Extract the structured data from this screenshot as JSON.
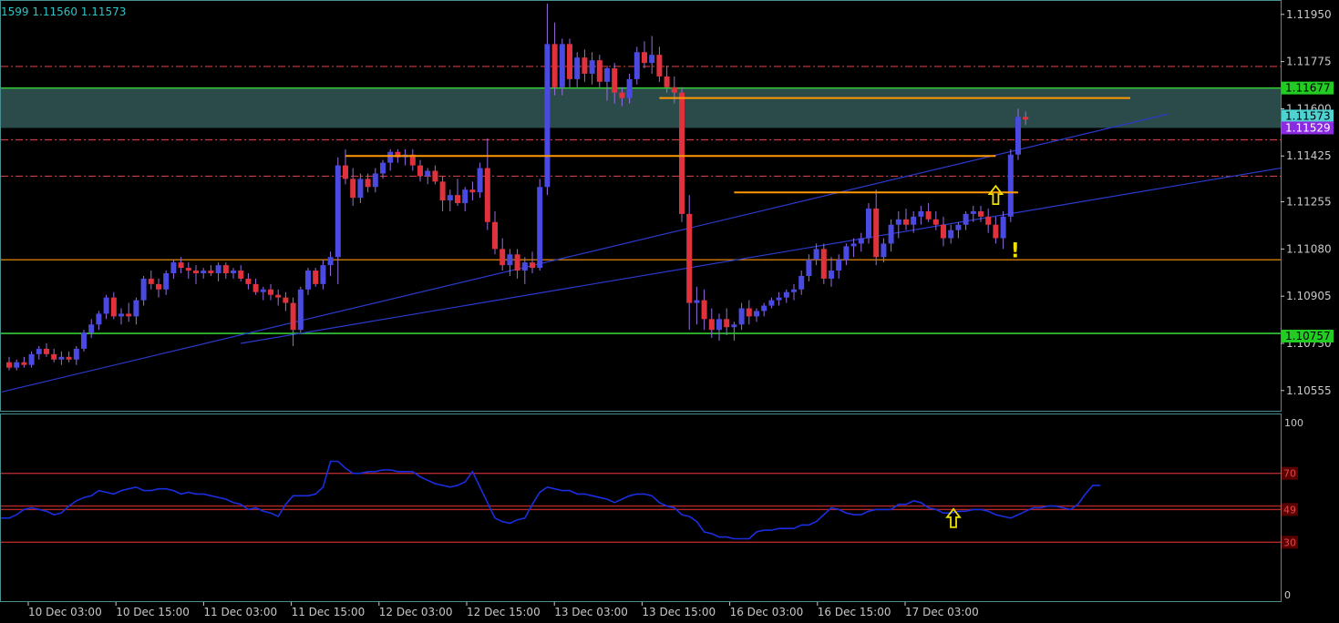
{
  "header": {
    "quote_text": "1599 1.11560 1.11573"
  },
  "colors": {
    "background": "#000000",
    "frame": "#4a8f8f",
    "bull": "#4a4ae0",
    "bear": "#e0323c",
    "wick": "#9a6de0",
    "support": "#ff9900",
    "zone_line": "#33cc33",
    "zone_fill": "#3a6464",
    "resistance_dash": "#c83c3c",
    "trend": "#2a3acc",
    "rsi_line": "#1a2ee0",
    "rsi_level": "#b42828",
    "arrow": "#f0e000",
    "axis_text": "#c8c8c8"
  },
  "chart_data": [
    {
      "type": "candlestick",
      "symbol": "",
      "price_axis_ticks": [
        "1.11950",
        "1.11775",
        "1.11600",
        "1.11425",
        "1.11255",
        "1.11080",
        "1.10905",
        "1.10730",
        "1.10555"
      ],
      "ylim": [
        1.1048,
        1.12
      ],
      "time_axis_ticks": [
        "10 Dec 03:00",
        "10 Dec 15:00",
        "11 Dec 03:00",
        "11 Dec 15:00",
        "12 Dec 03:00",
        "12 Dec 15:00",
        "13 Dec 03:00",
        "13 Dec 15:00",
        "16 Dec 03:00",
        "16 Dec 15:00",
        "17 Dec 03:00"
      ],
      "price_labels": [
        {
          "text": "1.11677",
          "value": 1.11677,
          "role": "zone-top"
        },
        {
          "text": "1.11573",
          "value": 1.11573,
          "role": "bid"
        },
        {
          "text": "1.11529",
          "value": 1.11529,
          "role": "zone-bottom"
        },
        {
          "text": "1.10757",
          "value": 1.10757,
          "role": "zone-line"
        }
      ],
      "zone": {
        "top": 1.11677,
        "bottom": 1.11529
      },
      "horizontal_lines": [
        {
          "value": 1.11757,
          "style": "dash-dot",
          "color": "resistance_dash"
        },
        {
          "value": 1.11677,
          "style": "solid",
          "color": "zone_line"
        },
        {
          "value": 1.11485,
          "style": "dash-dot",
          "color": "resistance_dash"
        },
        {
          "value": 1.1135,
          "style": "dash-dot",
          "color": "resistance_dash"
        },
        {
          "value": 1.1104,
          "style": "solid",
          "color": "support"
        },
        {
          "value": 1.10767,
          "style": "solid",
          "color": "zone_line"
        }
      ],
      "segment_levels": [
        {
          "value": 1.1164,
          "from_bar": 87,
          "to_bar": 150
        },
        {
          "value": 1.11425,
          "from_bar": 45,
          "to_bar": 132
        },
        {
          "value": 1.1129,
          "from_bar": 97,
          "to_bar": 135
        }
      ],
      "trend_lines": [
        {
          "from": {
            "bar": -1,
            "price": 1.1055
          },
          "to": {
            "bar": 155,
            "price": 1.1158
          }
        },
        {
          "from": {
            "bar": 31,
            "price": 1.1073
          },
          "to": {
            "bar": 176,
            "price": 1.1138
          }
        }
      ],
      "annotations": [
        {
          "type": "up-arrow",
          "bar": 132,
          "price": 1.1128
        },
        {
          "type": "exclamation",
          "text": "!",
          "bar": 134,
          "price": 1.1105
        }
      ],
      "ohlc": [
        [
          1.1066,
          1.1068,
          1.1063,
          1.1064
        ],
        [
          1.1064,
          1.1067,
          1.1063,
          1.1066
        ],
        [
          1.1066,
          1.1068,
          1.1064,
          1.1065
        ],
        [
          1.1065,
          1.107,
          1.1064,
          1.1069
        ],
        [
          1.1069,
          1.1072,
          1.1067,
          1.1071
        ],
        [
          1.1071,
          1.1073,
          1.1068,
          1.1069
        ],
        [
          1.1069,
          1.1071,
          1.1066,
          1.1067
        ],
        [
          1.1067,
          1.107,
          1.1065,
          1.1068
        ],
        [
          1.1068,
          1.107,
          1.1066,
          1.1067
        ],
        [
          1.1067,
          1.1072,
          1.1065,
          1.1071
        ],
        [
          1.1071,
          1.1078,
          1.107,
          1.1077
        ],
        [
          1.1077,
          1.1082,
          1.1075,
          1.108
        ],
        [
          1.108,
          1.1085,
          1.1078,
          1.1084
        ],
        [
          1.1084,
          1.1091,
          1.1082,
          1.109
        ],
        [
          1.109,
          1.1092,
          1.1082,
          1.1083
        ],
        [
          1.1083,
          1.1086,
          1.108,
          1.1084
        ],
        [
          1.1084,
          1.1088,
          1.1081,
          1.1083
        ],
        [
          1.1083,
          1.109,
          1.108,
          1.1089
        ],
        [
          1.1089,
          1.1098,
          1.1087,
          1.1097
        ],
        [
          1.1097,
          1.11,
          1.1093,
          1.1095
        ],
        [
          1.1095,
          1.1097,
          1.109,
          1.1093
        ],
        [
          1.1093,
          1.11,
          1.1091,
          1.1099
        ],
        [
          1.1099,
          1.1104,
          1.1097,
          1.1103
        ],
        [
          1.1103,
          1.1105,
          1.1099,
          1.1101
        ],
        [
          1.1101,
          1.1103,
          1.1097,
          1.11
        ],
        [
          1.11,
          1.1102,
          1.1095,
          1.1099
        ],
        [
          1.1099,
          1.1101,
          1.1097,
          1.11
        ],
        [
          1.11,
          1.1102,
          1.1098,
          1.1099
        ],
        [
          1.1099,
          1.1103,
          1.1096,
          1.1102
        ],
        [
          1.1102,
          1.1103,
          1.1097,
          1.1099
        ],
        [
          1.1099,
          1.1101,
          1.1097,
          1.11
        ],
        [
          1.11,
          1.1102,
          1.1096,
          1.1097
        ],
        [
          1.1097,
          1.1099,
          1.1093,
          1.1095
        ],
        [
          1.1095,
          1.1097,
          1.1091,
          1.1092
        ],
        [
          1.1092,
          1.1094,
          1.1089,
          1.1093
        ],
        [
          1.1093,
          1.1095,
          1.1089,
          1.1091
        ],
        [
          1.1091,
          1.1093,
          1.1087,
          1.109
        ],
        [
          1.109,
          1.1092,
          1.1085,
          1.1088
        ],
        [
          1.1088,
          1.109,
          1.1072,
          1.1078
        ],
        [
          1.1078,
          1.1094,
          1.1077,
          1.1093
        ],
        [
          1.1093,
          1.1101,
          1.1091,
          1.11
        ],
        [
          1.11,
          1.1101,
          1.1094,
          1.1095
        ],
        [
          1.1095,
          1.1104,
          1.1093,
          1.1102
        ],
        [
          1.1102,
          1.1107,
          1.1098,
          1.1105
        ],
        [
          1.1105,
          1.1142,
          1.1095,
          1.1139
        ],
        [
          1.1139,
          1.1145,
          1.1132,
          1.1134
        ],
        [
          1.1134,
          1.1138,
          1.1124,
          1.1127
        ],
        [
          1.1127,
          1.1136,
          1.1125,
          1.1134
        ],
        [
          1.1134,
          1.1136,
          1.1129,
          1.1131
        ],
        [
          1.1131,
          1.1138,
          1.1129,
          1.1136
        ],
        [
          1.1136,
          1.1141,
          1.1134,
          1.114
        ],
        [
          1.114,
          1.1145,
          1.1137,
          1.1144
        ],
        [
          1.1144,
          1.1145,
          1.114,
          1.1142
        ],
        [
          1.1142,
          1.1145,
          1.1139,
          1.1143
        ],
        [
          1.1143,
          1.1145,
          1.1137,
          1.1139
        ],
        [
          1.1139,
          1.1141,
          1.1133,
          1.1135
        ],
        [
          1.1135,
          1.1138,
          1.1132,
          1.1137
        ],
        [
          1.1137,
          1.1139,
          1.1132,
          1.1133
        ],
        [
          1.1133,
          1.1135,
          1.1122,
          1.1126
        ],
        [
          1.1126,
          1.113,
          1.1122,
          1.1128
        ],
        [
          1.1128,
          1.1134,
          1.1124,
          1.1125
        ],
        [
          1.1125,
          1.1131,
          1.1122,
          1.113
        ],
        [
          1.113,
          1.1133,
          1.1126,
          1.1129
        ],
        [
          1.1129,
          1.114,
          1.1127,
          1.1138
        ],
        [
          1.1138,
          1.1149,
          1.1115,
          1.1118
        ],
        [
          1.1118,
          1.1122,
          1.1106,
          1.1108
        ],
        [
          1.1108,
          1.1112,
          1.11,
          1.1102
        ],
        [
          1.1102,
          1.1108,
          1.1098,
          1.1106
        ],
        [
          1.1106,
          1.1108,
          1.1097,
          1.11
        ],
        [
          1.11,
          1.1105,
          1.1095,
          1.1103
        ],
        [
          1.1103,
          1.1107,
          1.1099,
          1.1101
        ],
        [
          1.1101,
          1.1134,
          1.11,
          1.1131
        ],
        [
          1.1131,
          1.1199,
          1.1128,
          1.1184
        ],
        [
          1.1184,
          1.1192,
          1.1165,
          1.1168
        ],
        [
          1.1168,
          1.1186,
          1.1165,
          1.1184
        ],
        [
          1.1184,
          1.1186,
          1.1168,
          1.1171
        ],
        [
          1.1171,
          1.1181,
          1.1168,
          1.1179
        ],
        [
          1.1179,
          1.1182,
          1.117,
          1.1173
        ],
        [
          1.1173,
          1.1181,
          1.1169,
          1.1178
        ],
        [
          1.1178,
          1.118,
          1.1168,
          1.117
        ],
        [
          1.117,
          1.1176,
          1.1163,
          1.1175
        ],
        [
          1.1175,
          1.1177,
          1.1162,
          1.1166
        ],
        [
          1.1166,
          1.1168,
          1.1161,
          1.1164
        ],
        [
          1.1164,
          1.1173,
          1.1162,
          1.1171
        ],
        [
          1.1171,
          1.1183,
          1.1169,
          1.1181
        ],
        [
          1.1181,
          1.1185,
          1.1175,
          1.1177
        ],
        [
          1.1177,
          1.1187,
          1.1173,
          1.118
        ],
        [
          1.118,
          1.1183,
          1.117,
          1.1172
        ],
        [
          1.1172,
          1.1176,
          1.1166,
          1.1168
        ],
        [
          1.1168,
          1.1172,
          1.1162,
          1.1166
        ],
        [
          1.1166,
          1.1168,
          1.1118,
          1.1121
        ],
        [
          1.1121,
          1.1128,
          1.1078,
          1.1088
        ],
        [
          1.1088,
          1.1094,
          1.108,
          1.1089
        ],
        [
          1.1089,
          1.1093,
          1.1078,
          1.1082
        ],
        [
          1.1082,
          1.1086,
          1.1075,
          1.1078
        ],
        [
          1.1078,
          1.1084,
          1.1074,
          1.1082
        ],
        [
          1.1082,
          1.1086,
          1.1076,
          1.1079
        ],
        [
          1.1079,
          1.1081,
          1.1074,
          1.108
        ],
        [
          1.108,
          1.1088,
          1.1078,
          1.1086
        ],
        [
          1.1086,
          1.1089,
          1.108,
          1.1083
        ],
        [
          1.1083,
          1.1086,
          1.1081,
          1.1085
        ],
        [
          1.1085,
          1.1088,
          1.1083,
          1.1087
        ],
        [
          1.1087,
          1.109,
          1.1086,
          1.1089
        ],
        [
          1.1089,
          1.1092,
          1.1087,
          1.109
        ],
        [
          1.109,
          1.1093,
          1.1088,
          1.1092
        ],
        [
          1.1092,
          1.1095,
          1.1089,
          1.1093
        ],
        [
          1.1093,
          1.11,
          1.1091,
          1.1098
        ],
        [
          1.1098,
          1.1106,
          1.1096,
          1.1104
        ],
        [
          1.1104,
          1.111,
          1.1102,
          1.1108
        ],
        [
          1.1108,
          1.111,
          1.1095,
          1.1097
        ],
        [
          1.1097,
          1.1105,
          1.1094,
          1.11
        ],
        [
          1.11,
          1.1106,
          1.1097,
          1.1104
        ],
        [
          1.1104,
          1.111,
          1.1102,
          1.1109
        ],
        [
          1.1109,
          1.1112,
          1.1105,
          1.111
        ],
        [
          1.111,
          1.1114,
          1.1107,
          1.1112
        ],
        [
          1.1112,
          1.1125,
          1.111,
          1.1123
        ],
        [
          1.1123,
          1.113,
          1.1102,
          1.1105
        ],
        [
          1.1105,
          1.1112,
          1.1103,
          1.111
        ],
        [
          1.111,
          1.1119,
          1.1107,
          1.1117
        ],
        [
          1.1117,
          1.1122,
          1.1112,
          1.1119
        ],
        [
          1.1119,
          1.1123,
          1.1115,
          1.1117
        ],
        [
          1.1117,
          1.1122,
          1.1114,
          1.112
        ],
        [
          1.112,
          1.1124,
          1.1117,
          1.1122
        ],
        [
          1.1122,
          1.1125,
          1.1118,
          1.1119
        ],
        [
          1.1119,
          1.1122,
          1.1115,
          1.1117
        ],
        [
          1.1117,
          1.112,
          1.1109,
          1.1112
        ],
        [
          1.1112,
          1.1117,
          1.111,
          1.1115
        ],
        [
          1.1115,
          1.1118,
          1.1112,
          1.1117
        ],
        [
          1.1117,
          1.1122,
          1.1115,
          1.1121
        ],
        [
          1.1121,
          1.1124,
          1.1118,
          1.1122
        ],
        [
          1.1122,
          1.1124,
          1.1118,
          1.112
        ],
        [
          1.112,
          1.1123,
          1.1114,
          1.1117
        ],
        [
          1.1117,
          1.112,
          1.111,
          1.1112
        ],
        [
          1.1112,
          1.1122,
          1.1108,
          1.112
        ],
        [
          1.112,
          1.1145,
          1.1118,
          1.1143
        ],
        [
          1.1143,
          1.116,
          1.1141,
          1.1157
        ],
        [
          1.1157,
          1.1159,
          1.1154,
          1.1156
        ]
      ]
    },
    {
      "type": "line",
      "indicator": "RSI",
      "axis_ticks": [
        "100",
        "0"
      ],
      "levels": [
        70,
        49,
        30
      ],
      "level_labels": [
        "70",
        "49",
        "30"
      ],
      "extra_level": 51,
      "ylim": [
        0,
        100
      ],
      "values": [
        44,
        44,
        44,
        46,
        49,
        50,
        49,
        48,
        46,
        47,
        51,
        54,
        56,
        57,
        60,
        59,
        58,
        60,
        61,
        62,
        60,
        60,
        61,
        61,
        60,
        58,
        59,
        58,
        58,
        57,
        56,
        55,
        53,
        52,
        49,
        50,
        48,
        47,
        45,
        52,
        57,
        57,
        57,
        58,
        62,
        77,
        77,
        73,
        70,
        70,
        71,
        71,
        72,
        72,
        71,
        71,
        71,
        68,
        66,
        64,
        63,
        62,
        63,
        65,
        71,
        62,
        53,
        44,
        42,
        41,
        43,
        44,
        52,
        59,
        62,
        61,
        60,
        60,
        58,
        58,
        57,
        56,
        55,
        53,
        55,
        57,
        58,
        58,
        57,
        53,
        51,
        50,
        46,
        45,
        42,
        36,
        35,
        33,
        33,
        32,
        32,
        32,
        36,
        37,
        37,
        38,
        38,
        38,
        40,
        40,
        42,
        46,
        50,
        49,
        47,
        46,
        46,
        48,
        49,
        49,
        49,
        52,
        52,
        54,
        53,
        50,
        49,
        47,
        47,
        48,
        48,
        49,
        49,
        48,
        46,
        45,
        44,
        46,
        48,
        50,
        50,
        51,
        51,
        50,
        49,
        52,
        58,
        63,
        63
      ]
    }
  ]
}
